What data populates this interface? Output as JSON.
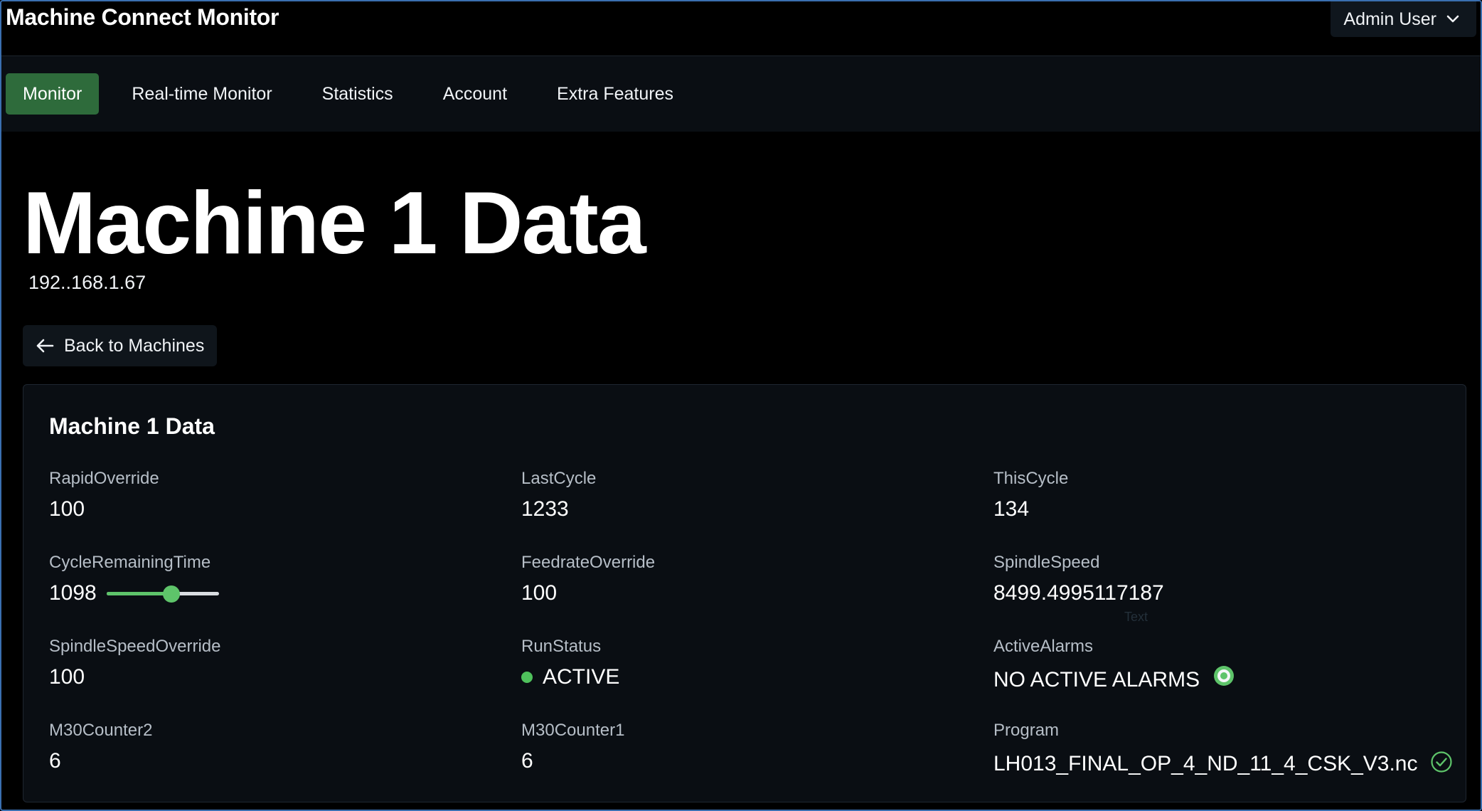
{
  "header": {
    "app_title": "Machine Connect Monitor",
    "user_label": "Admin User"
  },
  "nav": {
    "items": [
      {
        "label": "Monitor",
        "active": true
      },
      {
        "label": "Real-time Monitor",
        "active": false
      },
      {
        "label": "Statistics",
        "active": false
      },
      {
        "label": "Account",
        "active": false
      },
      {
        "label": "Extra Features",
        "active": false
      }
    ]
  },
  "page": {
    "title": "Machine 1 Data",
    "ip_address": "192..168.1.67",
    "back_label": "Back to Machines"
  },
  "card": {
    "title": "Machine 1 Data",
    "ghost_text": "Text",
    "fields": {
      "rapid_override": {
        "label": "RapidOverride",
        "value": "100"
      },
      "last_cycle": {
        "label": "LastCycle",
        "value": "1233"
      },
      "this_cycle": {
        "label": "ThisCycle",
        "value": "134"
      },
      "cycle_remaining_time": {
        "label": "CycleRemainingTime",
        "value": "1098",
        "slider_fraction": 0.58
      },
      "feedrate_override": {
        "label": "FeedrateOverride",
        "value": "100"
      },
      "spindle_speed": {
        "label": "SpindleSpeed",
        "value": "8499.4995117187"
      },
      "spindle_speed_override": {
        "label": "SpindleSpeedOverride",
        "value": "100"
      },
      "run_status": {
        "label": "RunStatus",
        "value": "ACTIVE"
      },
      "active_alarms": {
        "label": "ActiveAlarms",
        "value": "NO ACTIVE ALARMS"
      },
      "m30_counter2": {
        "label": "M30Counter2",
        "value": "6"
      },
      "m30_counter1": {
        "label": "M30Counter1",
        "value": "6"
      },
      "program": {
        "label": "Program",
        "value": "LH013_FINAL_OP_4_ND_11_4_CSK_V3.nc"
      }
    }
  },
  "colors": {
    "accent_green": "#2e6b3b",
    "status_green": "#4fc15c",
    "background": "#000000",
    "card_background": "#0a0e13"
  },
  "icons": {
    "user_menu": "chevron-down-icon",
    "back": "arrow-left-icon",
    "run_status": "status-dot-icon",
    "alarms": "radio-ring-icon",
    "program": "check-circle-icon"
  }
}
